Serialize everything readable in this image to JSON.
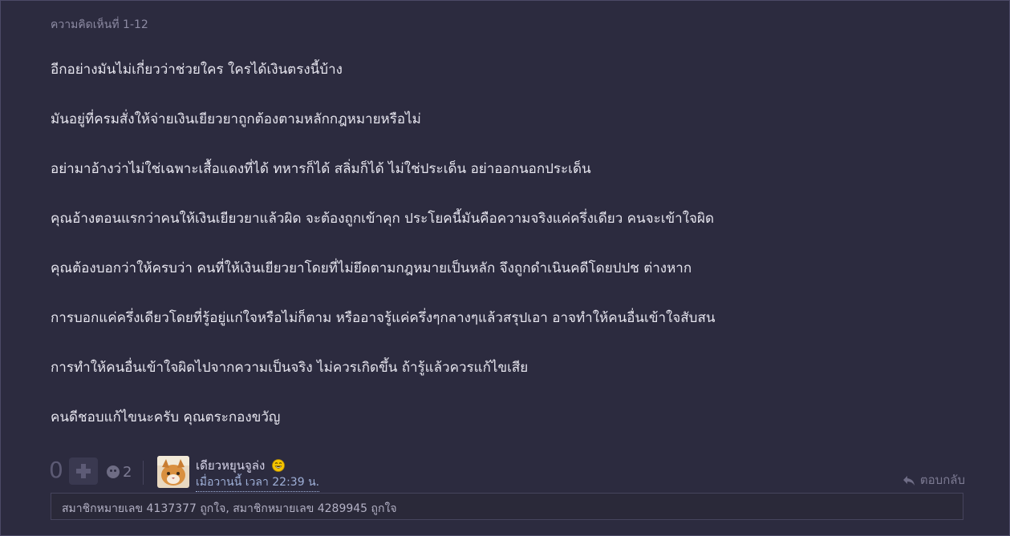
{
  "comment": {
    "header": "ความคิดเห็นที่ 1-12",
    "paragraphs": [
      "อีกอย่างมันไม่เกี่ยวว่าช่วยใคร ใครได้เงินตรงนี้บ้าง",
      "มันอยู่ที่ครมสั่งให้จ่ายเงินเยียวยาถูกต้องตามหลักกฎหมายหรือไม่",
      "อย่ามาอ้างว่าไม่ใช่เฉพาะเสื้อแดงที่ได้ ทหารก็ได้  สลิ่มก็ได้ ไม่ใช่ประเด็น อย่าออกนอกประเด็น",
      "คุณอ้างตอนแรกว่าคนให้เงินเยียวยาแล้วผิด จะต้องถูกเข้าคุก ประโยคนี้มันคือความจริงแค่ครึ่งเดียว คนจะเข้าใจผิด",
      "คุณต้องบอกว่าให้ครบว่า คนที่ให้เงินเยียวยาโดยที่ไม่ยึดตามกฎหมายเป็นหลัก จึงถูกดำเนินคดีโดยปปช ต่างหาก",
      "การบอกแค่ครึ่งเดียวโดยที่รู้อยู่แก่ใจหรือไม่ก็ตาม หรืออาจรู้แค่ครึ่งๆกลางๆแล้วสรุปเอา อาจทำให้คนอื่นเข้าใจสับสน",
      "การทำให้คนอื่นเข้าใจผิดไปจากความเป็นจริง ไม่ควรเกิดขึ้น ถ้ารู้แล้วควรแก้ไขเสีย",
      "คนดีชอบแก้ไขนะครับ คุณตระกองขวัญ"
    ]
  },
  "footer": {
    "vote_count": "0",
    "emoji_count": "2",
    "username": "เดียวหยุนจูล่ง",
    "timestamp": "เมื่อวานนี้ เวลา 22:39 น.",
    "reply_label": "ตอบกลับ"
  },
  "likers": "สมาชิกหมายเลข 4137377 ถูกใจ, สมาชิกหมายเลข 4289945 ถูกใจ",
  "icons": {
    "plus": "plus-icon",
    "emoji": "smile-icon",
    "laugh": "laugh-emoji-icon",
    "reply": "reply-arrow-icon"
  },
  "colors": {
    "background": "#2c2b3f",
    "text": "#e6e5ee",
    "muted": "#8d8ba3",
    "link": "#9fb0d8"
  }
}
